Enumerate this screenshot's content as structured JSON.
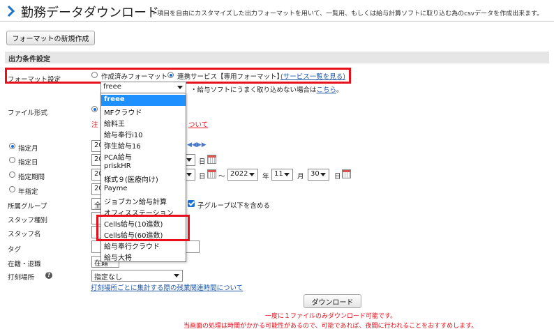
{
  "header": {
    "title": "勤務データダウンロード",
    "subtitle": "- 項目を自由にカスタマイズした出力フォーマットを用いて、一覧用、もしくは給与計算ソフトに取り込む為のcsvデータを作成出来ます。"
  },
  "toolbar": {
    "new_format_label": "フォーマットの新規作成"
  },
  "section_title": "出力条件設定",
  "format_setting": {
    "label": "フォーマット設定",
    "option_created": "作成済みフォーマット",
    "option_linked": "連携サービス【専用フォーマット】",
    "service_list_link": "(サービス一覧を見る)",
    "selected": "freee",
    "note_prefix": "・給与ソフトにうまく取り込めない場合は",
    "note_link": "こちら",
    "note_suffix": "。"
  },
  "dropdown_options": [
    "freee",
    "MFクラウド",
    "給料王",
    "給与奉行i10",
    "弥生給与16",
    "PCA給与",
    "priskHR",
    "様式９(医療向け)",
    "Payme",
    "ジョブカン給与計算",
    "オフィスステーション",
    "Cells給与(10進数)",
    "Cells給与(60進数)",
    "給与奉行クラウド",
    "給与大将"
  ],
  "file_format": {
    "label": "ファイル形式",
    "note_visible": "注",
    "note_visible_tail": "ついて"
  },
  "period": {
    "month_label": "指定月",
    "day_label": "指定日",
    "range_label": "指定期間",
    "year_label": "年指定",
    "year_prefix": "20",
    "day_unit": "日",
    "tilde": "〜",
    "end_year": "2022",
    "year_unit": "年",
    "end_month": "11",
    "month_unit": "月",
    "end_day": "30",
    "nav_arrows": "◀◀▶▶"
  },
  "group": {
    "label": "所属グループ",
    "value_visible": "全",
    "include_children": "子グループ以下を含める"
  },
  "staff_type": {
    "label": "スタッフ種別"
  },
  "staff_name": {
    "label": "スタッフ名"
  },
  "tag": {
    "label": "タグ"
  },
  "employment": {
    "label": "在籍・退職",
    "value_visible": "在籍"
  },
  "punch_location": {
    "label": "打刻場所",
    "value": "指定なし",
    "link": "打刻場所ごとに集計する際の残業関連時間について"
  },
  "download": {
    "label": "ダウンロード",
    "note1": "一度に１ファイルのみダウンロード可能です。",
    "note2": "当画面の処理は時間がかかる可能性があるので、可能であれば、夜間に行われることをおすすめします。"
  },
  "colors": {
    "highlight": "#e8101a",
    "accent": "#1a6ed8",
    "selected_option": "#1e90ff"
  }
}
